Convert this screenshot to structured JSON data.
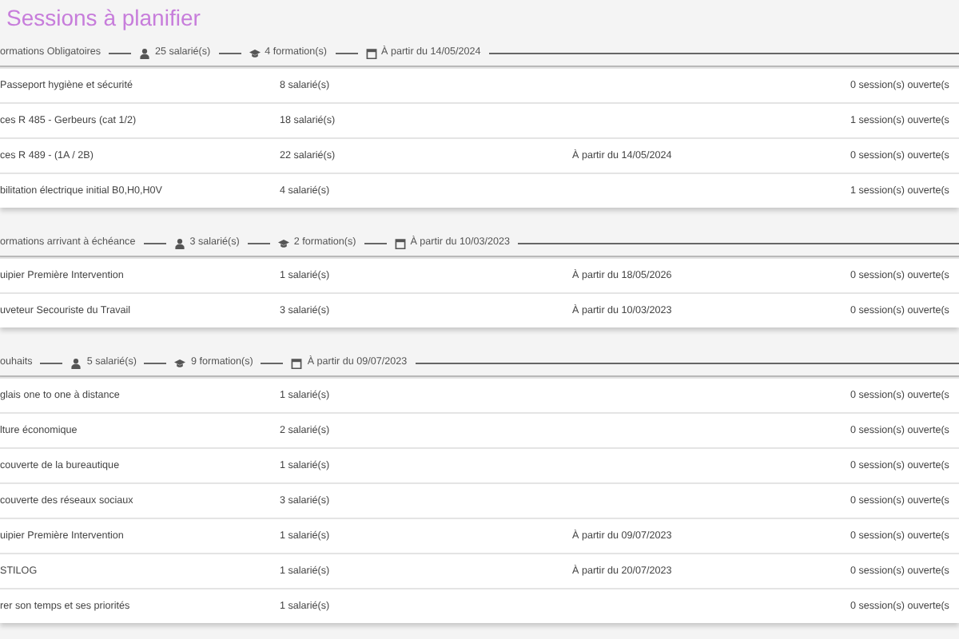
{
  "title": "Sessions à planifier",
  "groups": [
    {
      "label": "ormations Obligatoires",
      "employees": "25 salarié(s)",
      "trainings": "4 formation(s)",
      "start": "À partir du 14/05/2024",
      "rows": [
        {
          "name": "Passeport hygiène et sécurité",
          "employees": "8 salarié(s)",
          "sessions": "0 session(s) ouverte(s"
        },
        {
          "name": "ces R 485 - Gerbeurs (cat 1/2)",
          "employees": "18 salarié(s)",
          "sessions": "1 session(s) ouverte(s"
        },
        {
          "name": "ces R 489 - (1A / 2B)",
          "employees": "22 salarié(s)",
          "date": "À partir du 14/05/2024",
          "sessions": "0 session(s) ouverte(s"
        },
        {
          "name": "bilitation électrique initial B0,H0,H0V",
          "employees": "4 salarié(s)",
          "sessions": "1 session(s) ouverte(s"
        }
      ]
    },
    {
      "label": "ormations arrivant à échéance",
      "employees": "3 salarié(s)",
      "trainings": "2 formation(s)",
      "start": "À partir du 10/03/2023",
      "rows": [
        {
          "name": "uipier Première Intervention",
          "employees": "1 salarié(s)",
          "date": "À partir du 18/05/2026",
          "sessions": "0 session(s) ouverte(s"
        },
        {
          "name": "uveteur Secouriste du Travail",
          "employees": "3 salarié(s)",
          "date": "À partir du 10/03/2023",
          "sessions": "0 session(s) ouverte(s"
        }
      ]
    },
    {
      "label": "ouhaits",
      "employees": "5 salarié(s)",
      "trainings": "9 formation(s)",
      "start": "À partir du 09/07/2023",
      "rows": [
        {
          "name": "glais one to one à distance",
          "employees": "1 salarié(s)",
          "sessions": "0 session(s) ouverte(s"
        },
        {
          "name": "lture économique",
          "employees": "2 salarié(s)",
          "sessions": "0 session(s) ouverte(s"
        },
        {
          "name": "couverte de la bureautique",
          "employees": "1 salarié(s)",
          "sessions": "0 session(s) ouverte(s"
        },
        {
          "name": "couverte des réseaux sociaux",
          "employees": "3 salarié(s)",
          "sessions": "0 session(s) ouverte(s"
        },
        {
          "name": "uipier Première Intervention",
          "employees": "1 salarié(s)",
          "date": "À partir du 09/07/2023",
          "sessions": "0 session(s) ouverte(s"
        },
        {
          "name": "STILOG",
          "employees": "1 salarié(s)",
          "date": "À partir du 20/07/2023",
          "sessions": "0 session(s) ouverte(s"
        },
        {
          "name": "rer son temps et ses priorités",
          "employees": "1 salarié(s)",
          "sessions": "0 session(s) ouverte(s"
        }
      ]
    }
  ]
}
